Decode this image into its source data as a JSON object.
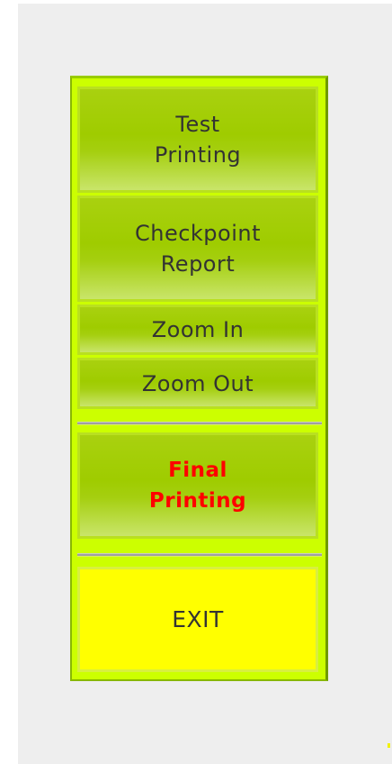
{
  "panel": {
    "buttons": {
      "test_printing": "Test\nPrinting",
      "checkpoint_report": "Checkpoint\nReport",
      "zoom_in": "Zoom In",
      "zoom_out": "Zoom Out",
      "final_printing": "Final\nPrinting",
      "exit": "EXIT"
    }
  },
  "colors": {
    "panel_background": "#ccff00",
    "button_green": "#9fcc00",
    "final_text": "#ff0000",
    "exit_background": "#ffff00",
    "separator": "#a0a0a0",
    "canvas": "#eeeeee"
  }
}
